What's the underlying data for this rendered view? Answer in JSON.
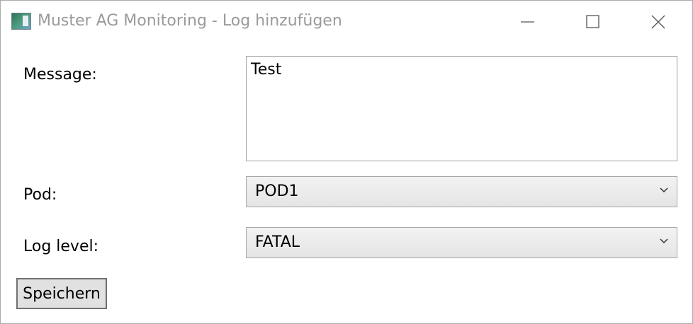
{
  "window": {
    "title": "Muster AG Monitoring - Log hinzufügen",
    "icon": "app-icon"
  },
  "form": {
    "message_label": "Message:",
    "message_value": "Test",
    "pod_label": "Pod:",
    "pod_selected": "POD1",
    "level_label": "Log level:",
    "level_selected": "FATAL"
  },
  "actions": {
    "save_label": "Speichern"
  }
}
